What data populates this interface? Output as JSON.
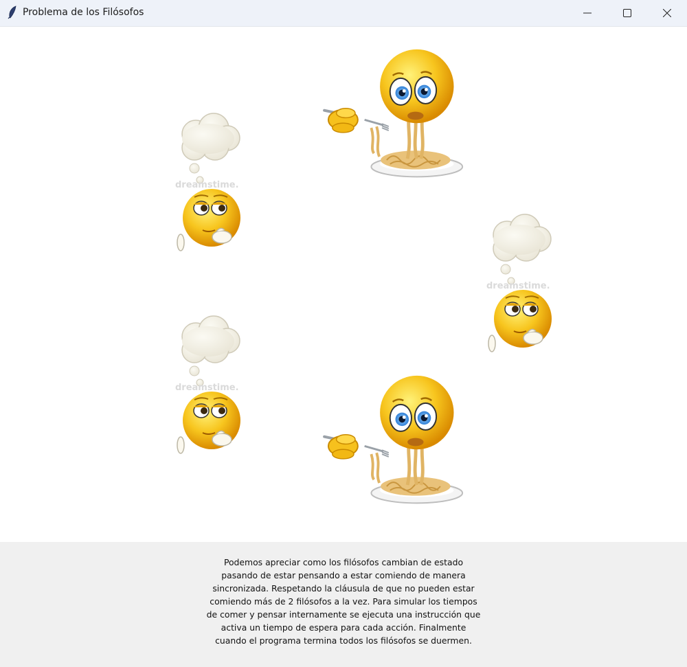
{
  "window": {
    "title": "Problema de los Filósofos",
    "app_icon": "feather-icon",
    "controls": [
      "minimize-icon",
      "maximize-icon",
      "close-icon"
    ]
  },
  "philosophers": [
    {
      "state": "eating",
      "icon": "eating-spaghetti-emoji",
      "watermark": ""
    },
    {
      "state": "thinking",
      "icon": "thinking-emoji",
      "watermark": "dreamstime."
    },
    {
      "state": "thinking",
      "icon": "thinking-emoji",
      "watermark": "dreamstime."
    },
    {
      "state": "thinking",
      "icon": "thinking-emoji",
      "watermark": "dreamstime."
    },
    {
      "state": "eating",
      "icon": "eating-spaghetti-emoji",
      "watermark": ""
    }
  ],
  "description": "Podemos apreciar como los filósofos cambian de estado pasando de estar pensando a estar comiendo de manera sincronizada. Respetando la cláusula de que no pueden estar comiendo más de 2 filósofos a la vez. Para simular los tiempos de comer y pensar internamente se ejecuta una instrucción que activa un tiempo de espera para cada acción. Finalmente cuando el programa termina todos los filósofos se duermen.",
  "colors": {
    "titlebar": "#eef2f9",
    "footer": "#f0f0f0",
    "emoji_yellow": "#f7c51e",
    "spaghetti": "#e9c27a"
  }
}
